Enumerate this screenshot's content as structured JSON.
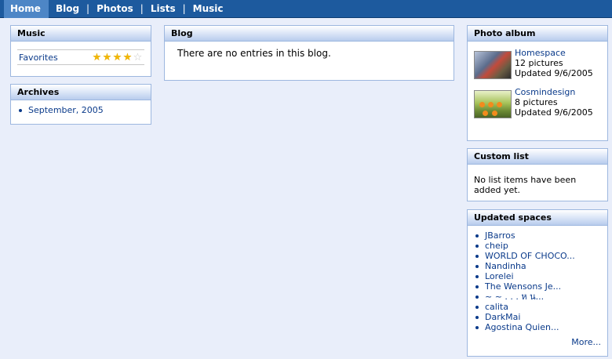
{
  "nav": {
    "items": [
      "Home",
      "Blog",
      "Photos",
      "Lists",
      "Music"
    ],
    "separator": "|"
  },
  "music": {
    "title": "Music",
    "favorites_label": "Favorites",
    "rating": 4,
    "rating_max": 5
  },
  "archives": {
    "title": "Archives",
    "items": [
      "September, 2005"
    ]
  },
  "blog": {
    "title": "Blog",
    "empty_text": "There are no entries in this blog."
  },
  "photo_album": {
    "title": "Photo album",
    "albums": [
      {
        "name": "Homespace",
        "count": "12 pictures",
        "updated": "Updated 9/6/2005"
      },
      {
        "name": "Cosmindesign",
        "count": "8 pictures",
        "updated": "Updated 9/6/2005"
      }
    ]
  },
  "custom_list": {
    "title": "Custom list",
    "empty_text": "No list items have been added yet."
  },
  "updated_spaces": {
    "title": "Updated spaces",
    "items": [
      "JBarros",
      "cheip",
      "WORLD OF CHOCO...",
      "Nandinha",
      "Lorelei",
      "The Wensons Je...",
      "~ ~ . . . ห น...",
      "calita",
      "DarkMai",
      "Agostina Quien..."
    ],
    "more_label": "More..."
  },
  "colors": {
    "nav_bg": "#1d5a9e",
    "nav_active": "#4d86c6",
    "page_bg": "#e9eefa",
    "link": "#0a3a8a",
    "border": "#9db7df"
  }
}
